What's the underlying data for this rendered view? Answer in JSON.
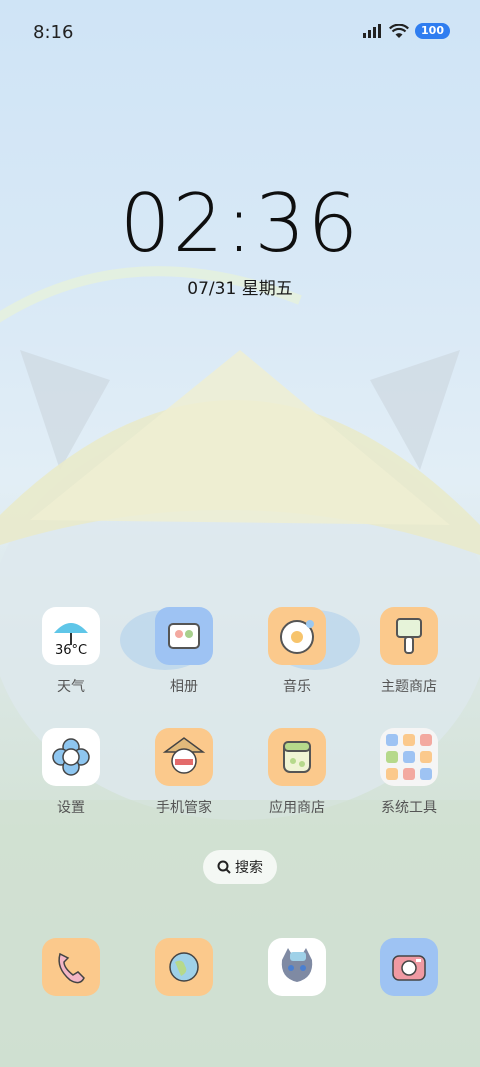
{
  "status_bar": {
    "time": "8:16",
    "battery": "100"
  },
  "clock_widget": {
    "time": "02:36",
    "date": "07/31 星期五"
  },
  "apps": [
    {
      "label": "天气",
      "icon": "weather-icon",
      "temp": "36°C"
    },
    {
      "label": "相册",
      "icon": "gallery-icon"
    },
    {
      "label": "音乐",
      "icon": "music-icon"
    },
    {
      "label": "主题商店",
      "icon": "theme-store-icon"
    },
    {
      "label": "设置",
      "icon": "settings-icon"
    },
    {
      "label": "手机管家",
      "icon": "phone-manager-icon"
    },
    {
      "label": "应用商店",
      "icon": "app-store-icon"
    },
    {
      "label": "系统工具",
      "icon": "system-tools-folder-icon"
    }
  ],
  "search": {
    "label": "搜索"
  },
  "dock": [
    {
      "icon": "phone-icon"
    },
    {
      "icon": "browser-icon"
    },
    {
      "icon": "messages-icon"
    },
    {
      "icon": "camera-icon"
    }
  ]
}
